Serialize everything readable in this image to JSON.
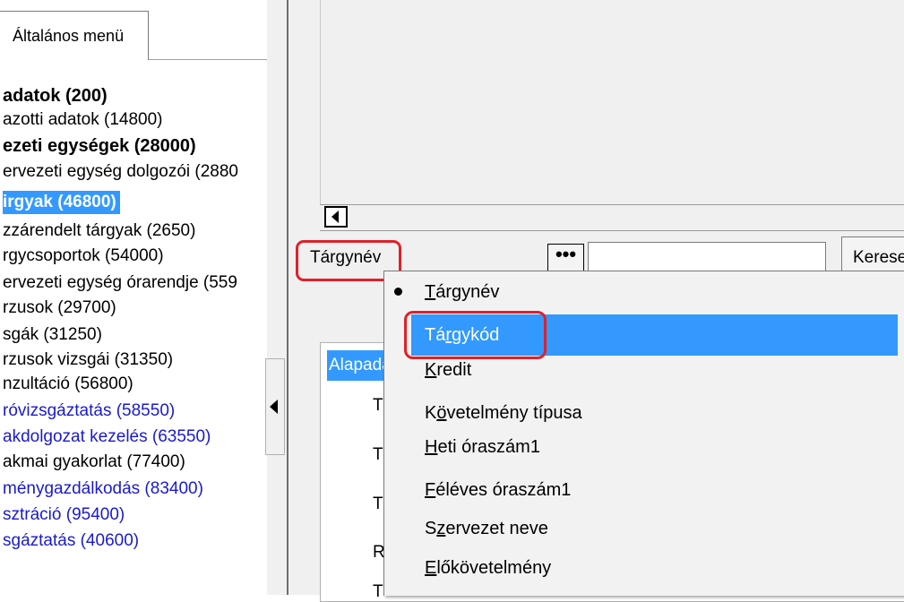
{
  "left_panel": {
    "tab_label": "Általános menü",
    "items": [
      {
        "label": "adatok (200)",
        "style": "bold"
      },
      {
        "label": "azotti adatok (14800)",
        "style": "normal"
      },
      {
        "label": "ezeti egységek (28000)",
        "style": "bold"
      },
      {
        "label": "ervezeti egység dolgozói (2880",
        "style": "normal"
      },
      {
        "label": "irgyak (46800)",
        "style": "selected"
      },
      {
        "label": "zzárendelt tárgyak (2650)",
        "style": "normal"
      },
      {
        "label": "rgycsoportok (54000)",
        "style": "normal"
      },
      {
        "label": "ervezeti egység órarendje (559",
        "style": "normal"
      },
      {
        "label": "rzusok (29700)",
        "style": "normal"
      },
      {
        "label": "sgák (31250)",
        "style": "normal"
      },
      {
        "label": "rzusok vizsgái (31350)",
        "style": "normal"
      },
      {
        "label": "nzultáció (56800)",
        "style": "normal"
      },
      {
        "label": "róvizsgáztatás (58550)",
        "style": "link"
      },
      {
        "label": "akdolgozat kezelés (63550)",
        "style": "link"
      },
      {
        "label": "akmai gyakorlat (77400)",
        "style": "normal"
      },
      {
        "label": "ménygazdálkodás (83400)",
        "style": "link"
      },
      {
        "label": "sztráció (95400)",
        "style": "link"
      },
      {
        "label": "sgáztatás (40600)",
        "style": "link"
      }
    ]
  },
  "search": {
    "field_label": "Tárgynév",
    "browse_label": "•••",
    "input_value": "",
    "button_label": "Kereses"
  },
  "detail": {
    "group_caption": "Alapadatok",
    "labels": [
      "T",
      "T",
      "T",
      "R",
      "T"
    ]
  },
  "dropdown": {
    "selected_index": 0,
    "highlighted_index": 1,
    "items": [
      {
        "pre": "",
        "acc": "T",
        "post": "árgynév"
      },
      {
        "pre": "Tá",
        "acc": "r",
        "post": "gykód"
      },
      {
        "pre": "",
        "acc": "K",
        "post": "redit"
      },
      {
        "pre": "K",
        "acc": "ö",
        "post": "vetelmény típusa"
      },
      {
        "pre": "",
        "acc": "H",
        "post": "eti óraszám1"
      },
      {
        "pre": "",
        "acc": "F",
        "post": "éléves óraszám1"
      },
      {
        "pre": "S",
        "acc": "z",
        "post": "ervezet neve"
      },
      {
        "pre": "",
        "acc": "E",
        "post": "lőkövetelmény"
      }
    ]
  },
  "colors": {
    "selection": "#3399ff",
    "link": "#1a1acc",
    "annotation_red": "#e0202a",
    "panel_bg": "#f0f0f0"
  }
}
